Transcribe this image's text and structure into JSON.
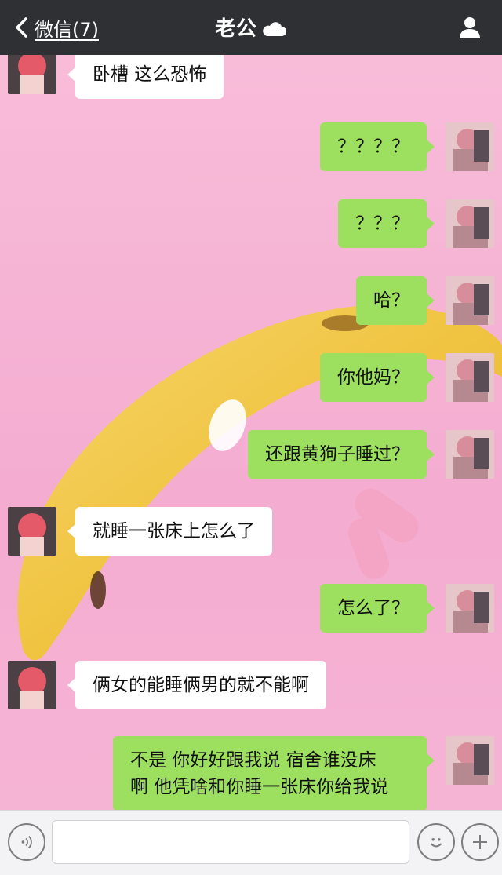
{
  "header": {
    "back_label": "微信(7)",
    "title": "老公",
    "title_icon": "cloud-icon",
    "right_icon": "person-icon"
  },
  "messages": [
    {
      "side": "left",
      "text": "卧槽  这么恐怖"
    },
    {
      "side": "right",
      "text": "？？？？"
    },
    {
      "side": "right",
      "text": "？？？"
    },
    {
      "side": "right",
      "text": "哈？"
    },
    {
      "side": "right",
      "text": "你他妈？"
    },
    {
      "side": "right",
      "text": "还跟黄狗子睡过？"
    },
    {
      "side": "left",
      "text": "就睡一张床上怎么了"
    },
    {
      "side": "right",
      "text": "怎么了？"
    },
    {
      "side": "left",
      "text": "俩女的能睡俩男的就不能啊"
    },
    {
      "side": "right",
      "lines": [
        "不是  你好好跟我说  宿舍谁没床",
        "啊  他凭啥和你睡一张床你给我说"
      ]
    }
  ],
  "input_bar": {
    "voice_icon": "voice-icon",
    "input_value": "",
    "emoji_icon": "emoji-icon",
    "plus_icon": "plus-icon"
  },
  "colors": {
    "header_bg": "#2f3034",
    "chat_bg": "#f6b7d4",
    "bubble_green": "#9de060",
    "bubble_white": "#ffffff"
  }
}
